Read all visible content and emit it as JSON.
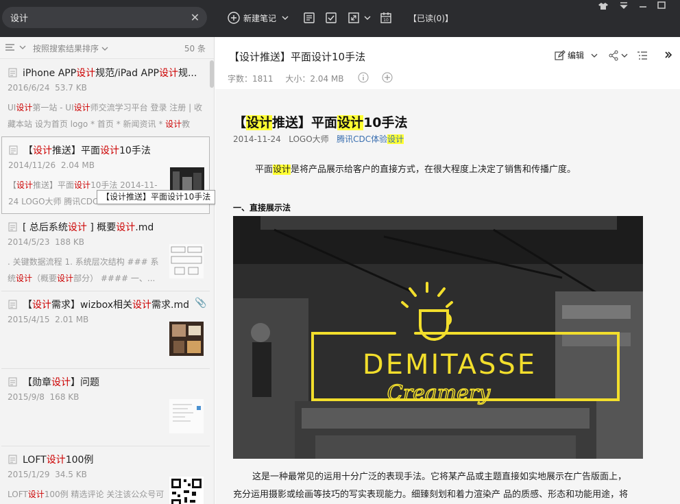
{
  "search": {
    "value": "设计"
  },
  "toolbar": {
    "new_note": "新建笔记",
    "read_status": "【已读(0)】"
  },
  "list": {
    "sort_label": "按照搜索结果排序",
    "count": "50 条",
    "tooltip": "【设计推送】平面设计10手法",
    "notes": [
      {
        "title_parts": [
          "iPhone APP",
          "设计",
          "规范/iPad APP",
          "设计",
          "规..."
        ],
        "date": "2016/6/24",
        "size": "53.7 KB",
        "snippet_parts": [
          "UI",
          "设计",
          "第一站 - UI",
          "设计",
          "师交流学习平台 登录 注册 | 收藏本站 设为首页 logo  * 首页  * 新闻资讯  * ",
          "设计",
          "教"
        ]
      },
      {
        "title_parts": [
          "【",
          "设计",
          "推送】平面",
          "设计",
          "10手法"
        ],
        "date": "2014/11/26",
        "size": "2.04 MB",
        "snippet_parts": [
          "【",
          "设计",
          "推送】平面",
          "设计",
          "10手法  2014-11-24 LOGO大师 腾讯CDC"
        ]
      },
      {
        "title_parts": [
          "[ 总后系统",
          "设计",
          " ] 概要",
          "设计",
          ".md"
        ],
        "date": "2014/5/23",
        "size": "188 KB",
        "snippet_parts": [
          ". 关键数据流程 1. 系统层次结构      ### 系统",
          "设计",
          "（概要",
          "设计",
          "部分） #### 一、..."
        ]
      },
      {
        "title_parts": [
          "【",
          "设计",
          "需求】wizbox相关",
          "设计",
          "需求.md"
        ],
        "date": "2015/4/15",
        "size": "2.01 MB",
        "snippet_parts": []
      },
      {
        "title_parts": [
          "【勋章",
          "设计",
          "】问题"
        ],
        "date": "2015/9/8",
        "size": "168 KB",
        "snippet_parts": []
      },
      {
        "title_parts": [
          "LOFT",
          "设计",
          "100例"
        ],
        "date": "2015/1/29",
        "size": "34.5 KB",
        "snippet_parts": [
          "LOFT",
          "设计",
          "100例 精选评论 关注该公众号可"
        ]
      }
    ]
  },
  "note": {
    "title": "【设计推送】平面设计10手法",
    "word_count": "字数：1811",
    "size": "大小：2.04 MB",
    "edit_label": "编辑",
    "content": {
      "title_parts": [
        "【",
        "设计",
        "推送】平面",
        "设计",
        "10手法"
      ],
      "date": "2014-11-24",
      "author": "LOGO大师",
      "source_parts": [
        "腾讯CDC体验",
        "设计"
      ],
      "para1_parts": [
        "平面",
        "设计",
        "是将产品展示给客户的直接方式，在很大程度上决定了销售和传播广度。"
      ],
      "heading1": "一、直接展示法",
      "logo_main": "DEMITASSE",
      "logo_script": "Creamery",
      "para2": "这是一种最常见的运用十分广泛的表现手法。它将某产品或主题直接如实地展示在广告版面上，",
      "para3": "充分运用摄影或绘画等技巧的写实表现能力。细臻刻划和着力渲染产 品的质感、形态和功能用途，将"
    }
  },
  "colors": {
    "topbar": "#2b2c2f",
    "highlight_red": "#cc0000",
    "highlight_yellow": "#ffff33",
    "logo_yellow": "#f2de2c"
  }
}
